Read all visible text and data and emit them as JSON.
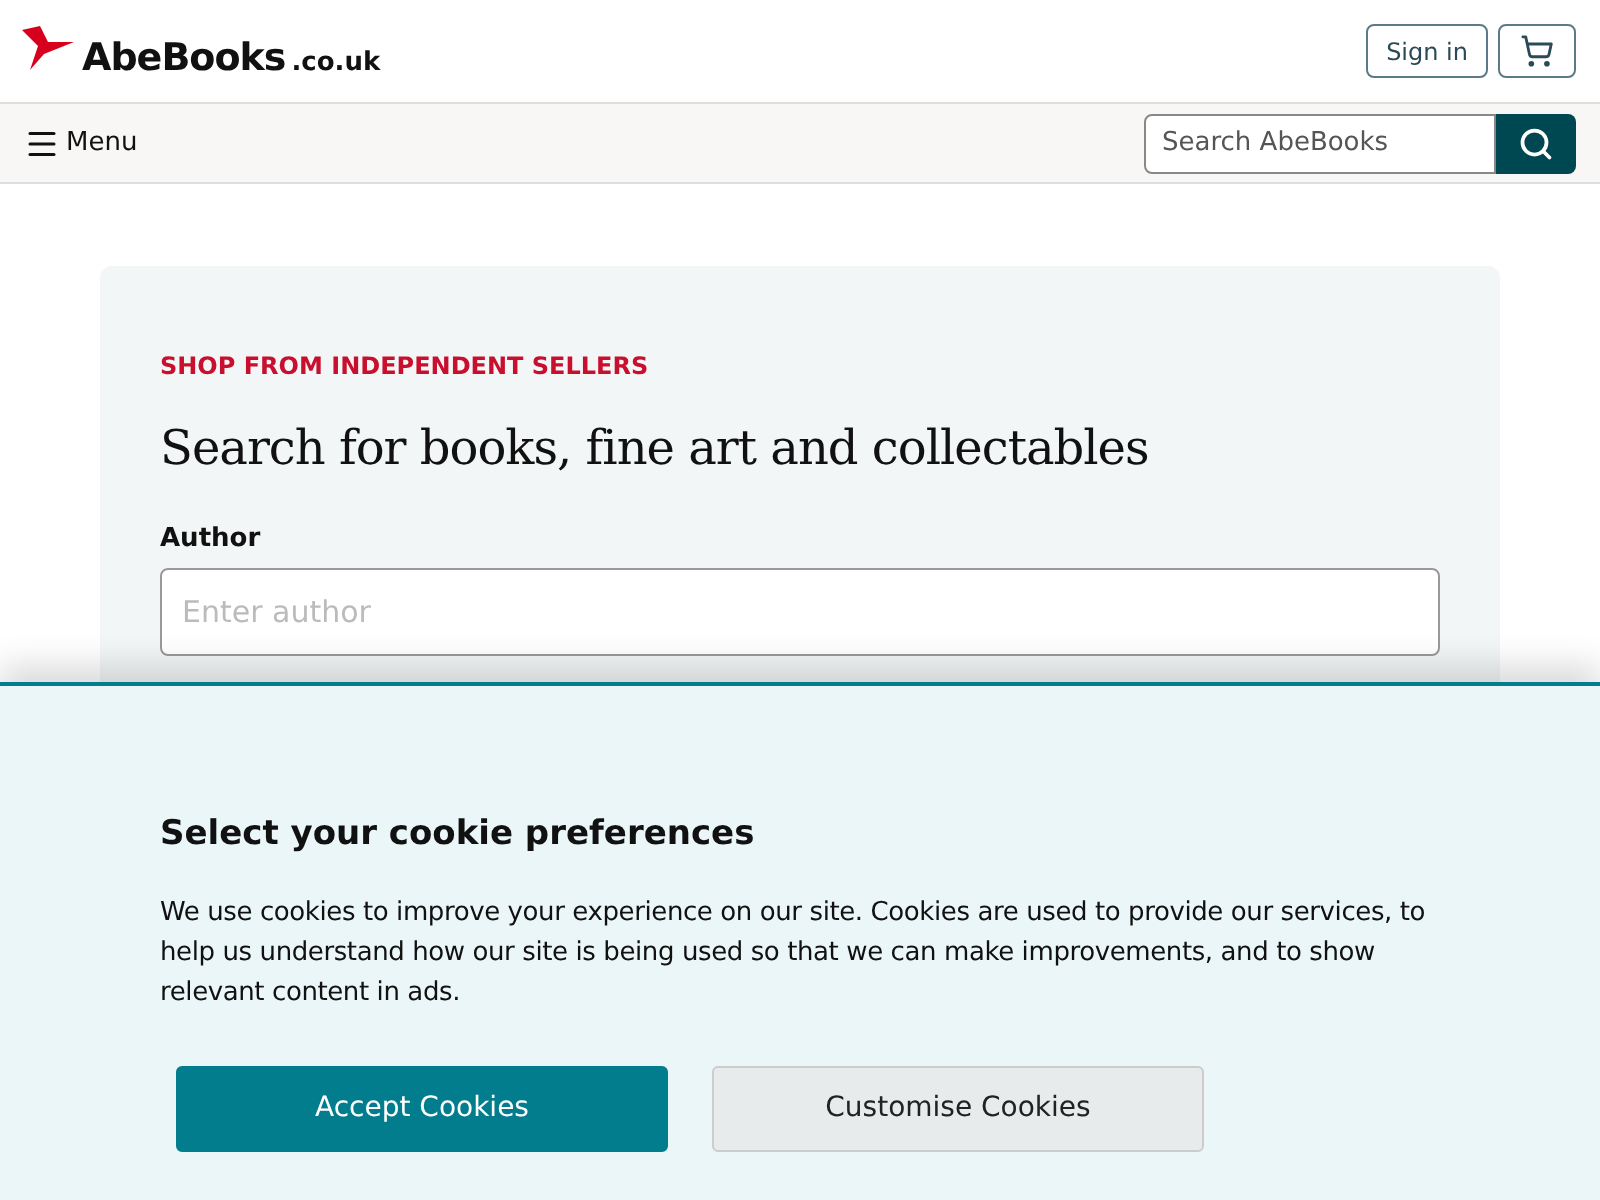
{
  "header": {
    "logo": {
      "name": "AbeBooks",
      "suffix": ".co.uk"
    },
    "sign_in": "Sign in"
  },
  "nav": {
    "menu": "Menu",
    "search": {
      "placeholder": "Search AbeBooks"
    }
  },
  "search_card": {
    "eyebrow": "SHOP FROM INDEPENDENT SELLERS",
    "title": "Search for books, fine art and collectables",
    "fields": [
      {
        "label": "Author",
        "placeholder": "Enter author"
      }
    ]
  },
  "cookie_banner": {
    "title": "Select your cookie preferences",
    "text": "We use cookies to improve your experience on our site. Cookies are used to provide our services, to help us understand how our site is being used so that we can make improvements, and to show relevant content in ads.",
    "buttons": [
      {
        "label": "Accept Cookies",
        "kind": "primary"
      },
      {
        "label": "Customise Cookies",
        "kind": "secondary"
      }
    ]
  }
}
